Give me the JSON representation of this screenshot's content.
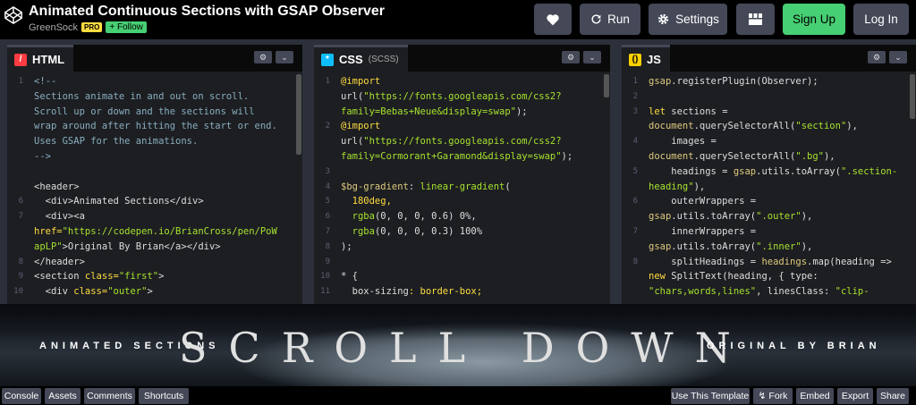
{
  "header": {
    "title": "Animated Continuous Sections with GSAP Observer",
    "author": "GreenSock",
    "pro_badge": "PRO",
    "follow": "+ Follow",
    "run": "Run",
    "settings": "Settings",
    "signup": "Sign Up",
    "login": "Log In"
  },
  "editors": {
    "html": {
      "tab": "HTML"
    },
    "css": {
      "tab": "CSS",
      "sub": "(SCSS)"
    },
    "js": {
      "tab": "JS"
    }
  },
  "html_lines": [
    {
      "n": "1",
      "segs": [
        {
          "t": "<!--",
          "c": "c-cm"
        }
      ]
    },
    {
      "n": "",
      "segs": [
        {
          "t": "Sections animate in and out on scroll.",
          "c": "c-cm"
        }
      ]
    },
    {
      "n": "",
      "segs": [
        {
          "t": "Scroll up or down and the sections will",
          "c": "c-cm"
        }
      ]
    },
    {
      "n": "",
      "segs": [
        {
          "t": "wrap around after hitting the start or end.",
          "c": "c-cm"
        }
      ]
    },
    {
      "n": "",
      "segs": [
        {
          "t": "Uses GSAP for the animations.",
          "c": "c-cm"
        }
      ]
    },
    {
      "n": "",
      "segs": [
        {
          "t": "-->",
          "c": "c-cm"
        }
      ]
    },
    {
      "n": "",
      "segs": [
        {
          "t": "",
          "c": ""
        }
      ]
    },
    {
      "n": "",
      "segs": [
        {
          "t": "<header>",
          "c": "c-tag"
        }
      ]
    },
    {
      "n": "6",
      "segs": [
        {
          "t": "  <div>",
          "c": "c-tag"
        },
        {
          "t": "Animated Sections",
          "c": "lc"
        },
        {
          "t": "</div>",
          "c": "c-tag"
        }
      ]
    },
    {
      "n": "7",
      "segs": [
        {
          "t": "  <div><a",
          "c": "c-tag"
        }
      ]
    },
    {
      "n": "",
      "segs": [
        {
          "t": "href=",
          "c": "c-at"
        },
        {
          "t": "\"https://codepen.io/BrianCross/pen/PoW",
          "c": "c-str"
        }
      ]
    },
    {
      "n": "",
      "segs": [
        {
          "t": "apLP\"",
          "c": "c-str"
        },
        {
          "t": ">Original By Brian",
          "c": "lc"
        },
        {
          "t": "</a></div>",
          "c": "c-tag"
        }
      ]
    },
    {
      "n": "8",
      "segs": [
        {
          "t": "</header>",
          "c": "c-tag"
        }
      ]
    },
    {
      "n": "9",
      "segs": [
        {
          "t": "<section ",
          "c": "c-tag"
        },
        {
          "t": "class=",
          "c": "c-at"
        },
        {
          "t": "\"first\"",
          "c": "c-str"
        },
        {
          "t": ">",
          "c": "c-tag"
        }
      ]
    },
    {
      "n": "10",
      "segs": [
        {
          "t": "  <div ",
          "c": "c-tag"
        },
        {
          "t": "class=",
          "c": "c-at"
        },
        {
          "t": "\"outer\"",
          "c": "c-str"
        },
        {
          "t": ">",
          "c": "c-tag"
        }
      ]
    }
  ],
  "css_lines": [
    {
      "n": "1",
      "segs": [
        {
          "t": "@import",
          "c": "c-kw"
        }
      ]
    },
    {
      "n": "",
      "segs": [
        {
          "t": "url(",
          "c": "lc"
        },
        {
          "t": "\"https://fonts.googleapis.com/css2?",
          "c": "c-str"
        }
      ]
    },
    {
      "n": "",
      "segs": [
        {
          "t": "family=Bebas+Neue&display=swap\"",
          "c": "c-str"
        },
        {
          "t": ");",
          "c": "lc"
        }
      ]
    },
    {
      "n": "2",
      "segs": [
        {
          "t": "@import",
          "c": "c-kw"
        }
      ]
    },
    {
      "n": "",
      "segs": [
        {
          "t": "url(",
          "c": "lc"
        },
        {
          "t": "\"https://fonts.googleapis.com/css2?",
          "c": "c-str"
        }
      ]
    },
    {
      "n": "",
      "segs": [
        {
          "t": "family=Cormorant+Garamond&display=swap\"",
          "c": "c-str"
        },
        {
          "t": ");",
          "c": "lc"
        }
      ]
    },
    {
      "n": "3",
      "segs": [
        {
          "t": "",
          "c": ""
        }
      ]
    },
    {
      "n": "4",
      "segs": [
        {
          "t": "$bg-gradient",
          "c": "c-var"
        },
        {
          "t": ": ",
          "c": "lc"
        },
        {
          "t": "linear-gradient",
          "c": "c-fn"
        },
        {
          "t": "(",
          "c": "lc"
        }
      ]
    },
    {
      "n": "5",
      "segs": [
        {
          "t": "  180deg,",
          "c": "c-num"
        }
      ]
    },
    {
      "n": "6",
      "segs": [
        {
          "t": "  rgba",
          "c": "c-fn"
        },
        {
          "t": "(0, 0, 0, 0.6) 0%,",
          "c": "lc"
        }
      ]
    },
    {
      "n": "7",
      "segs": [
        {
          "t": "  rgba",
          "c": "c-fn"
        },
        {
          "t": "(0, 0, 0, 0.3) 100%",
          "c": "lc"
        }
      ]
    },
    {
      "n": "8",
      "segs": [
        {
          "t": ");",
          "c": "lc"
        }
      ]
    },
    {
      "n": "9",
      "segs": [
        {
          "t": "",
          "c": ""
        }
      ]
    },
    {
      "n": "10",
      "segs": [
        {
          "t": "* {",
          "c": "lc"
        }
      ]
    },
    {
      "n": "11",
      "segs": [
        {
          "t": "  box-sizing",
          "c": "lc"
        },
        {
          "t": ": border-box;",
          "c": "c-kw"
        }
      ]
    }
  ],
  "js_lines": [
    {
      "n": "1",
      "segs": [
        {
          "t": "gsap",
          "c": "c-var"
        },
        {
          "t": ".registerPlugin(Observer);",
          "c": "lc"
        }
      ]
    },
    {
      "n": "2",
      "segs": [
        {
          "t": "",
          "c": ""
        }
      ]
    },
    {
      "n": "3",
      "segs": [
        {
          "t": "let ",
          "c": "c-kw"
        },
        {
          "t": "sections =",
          "c": "lc"
        }
      ]
    },
    {
      "n": "",
      "segs": [
        {
          "t": "document",
          "c": "c-var"
        },
        {
          "t": ".querySelectorAll(",
          "c": "lc"
        },
        {
          "t": "\"section\"",
          "c": "c-str"
        },
        {
          "t": "),",
          "c": "lc"
        }
      ]
    },
    {
      "n": "4",
      "segs": [
        {
          "t": "    images =",
          "c": "lc"
        }
      ]
    },
    {
      "n": "",
      "segs": [
        {
          "t": "document",
          "c": "c-var"
        },
        {
          "t": ".querySelectorAll(",
          "c": "lc"
        },
        {
          "t": "\".bg\"",
          "c": "c-str"
        },
        {
          "t": "),",
          "c": "lc"
        }
      ]
    },
    {
      "n": "5",
      "segs": [
        {
          "t": "    headings = ",
          "c": "lc"
        },
        {
          "t": "gsap",
          "c": "c-var"
        },
        {
          "t": ".utils.toArray(",
          "c": "lc"
        },
        {
          "t": "\".section-",
          "c": "c-str"
        }
      ]
    },
    {
      "n": "",
      "segs": [
        {
          "t": "heading\"",
          "c": "c-str"
        },
        {
          "t": "),",
          "c": "lc"
        }
      ]
    },
    {
      "n": "6",
      "segs": [
        {
          "t": "    outerWrappers =",
          "c": "lc"
        }
      ]
    },
    {
      "n": "",
      "segs": [
        {
          "t": "gsap",
          "c": "c-var"
        },
        {
          "t": ".utils.toArray(",
          "c": "lc"
        },
        {
          "t": "\".outer\"",
          "c": "c-str"
        },
        {
          "t": "),",
          "c": "lc"
        }
      ]
    },
    {
      "n": "7",
      "segs": [
        {
          "t": "    innerWrappers =",
          "c": "lc"
        }
      ]
    },
    {
      "n": "",
      "segs": [
        {
          "t": "gsap",
          "c": "c-var"
        },
        {
          "t": ".utils.toArray(",
          "c": "lc"
        },
        {
          "t": "\".inner\"",
          "c": "c-str"
        },
        {
          "t": "),",
          "c": "lc"
        }
      ]
    },
    {
      "n": "8",
      "segs": [
        {
          "t": "    splitHeadings = ",
          "c": "lc"
        },
        {
          "t": "headings",
          "c": "c-var"
        },
        {
          "t": ".map(heading =>",
          "c": "lc"
        }
      ]
    },
    {
      "n": "",
      "segs": [
        {
          "t": "new ",
          "c": "c-kw"
        },
        {
          "t": "SplitText(heading, { type:",
          "c": "lc"
        }
      ]
    },
    {
      "n": "",
      "segs": [
        {
          "t": "\"chars,words,lines\"",
          "c": "c-str"
        },
        {
          "t": ", linesClass: ",
          "c": "lc"
        },
        {
          "t": "\"clip-",
          "c": "c-str"
        }
      ]
    }
  ],
  "preview": {
    "left": "ANIMATED SECTIONS",
    "center": "SCROLL DOWN",
    "right": "ORIGINAL BY BRIAN"
  },
  "footer": {
    "console": "Console",
    "assets": "Assets",
    "comments": "Comments",
    "shortcuts": "Shortcuts",
    "template": "Use This Template",
    "fork": "Fork",
    "embed": "Embed",
    "export": "Export",
    "share": "Share"
  }
}
